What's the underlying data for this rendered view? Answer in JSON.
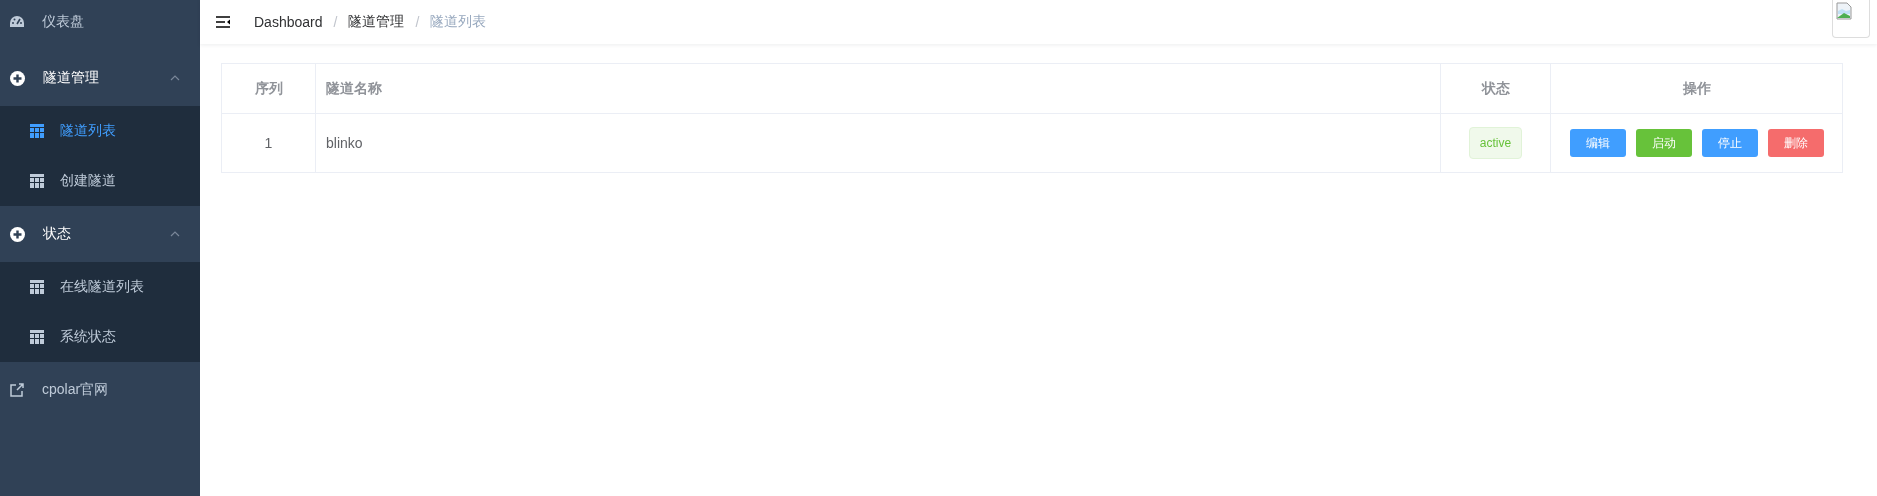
{
  "sidebar": {
    "items": [
      {
        "kind": "dashboard",
        "label": "仪表盘"
      },
      {
        "kind": "group",
        "label": "隧道管理",
        "expanded": true,
        "children": [
          {
            "label": "隧道列表",
            "selected": true
          },
          {
            "label": "创建隧道",
            "selected": false
          }
        ]
      },
      {
        "kind": "group",
        "label": "状态",
        "expanded": true,
        "children": [
          {
            "label": "在线隧道列表",
            "selected": false
          },
          {
            "label": "系统状态",
            "selected": false
          }
        ]
      },
      {
        "kind": "external",
        "label": "cpolar官网"
      }
    ]
  },
  "breadcrumb": {
    "items": [
      "Dashboard",
      "隧道管理",
      "隧道列表"
    ],
    "separators": [
      "/",
      "/"
    ]
  },
  "table": {
    "columns": [
      "序列",
      "隧道名称",
      "状态",
      "操作"
    ],
    "rows": [
      {
        "index": "1",
        "name": "blinko",
        "status": "active",
        "actions": [
          {
            "label": "编辑",
            "kind": "primary"
          },
          {
            "label": "启动",
            "kind": "success"
          },
          {
            "label": "停止",
            "kind": "primary"
          },
          {
            "label": "删除",
            "kind": "danger"
          }
        ]
      }
    ]
  }
}
